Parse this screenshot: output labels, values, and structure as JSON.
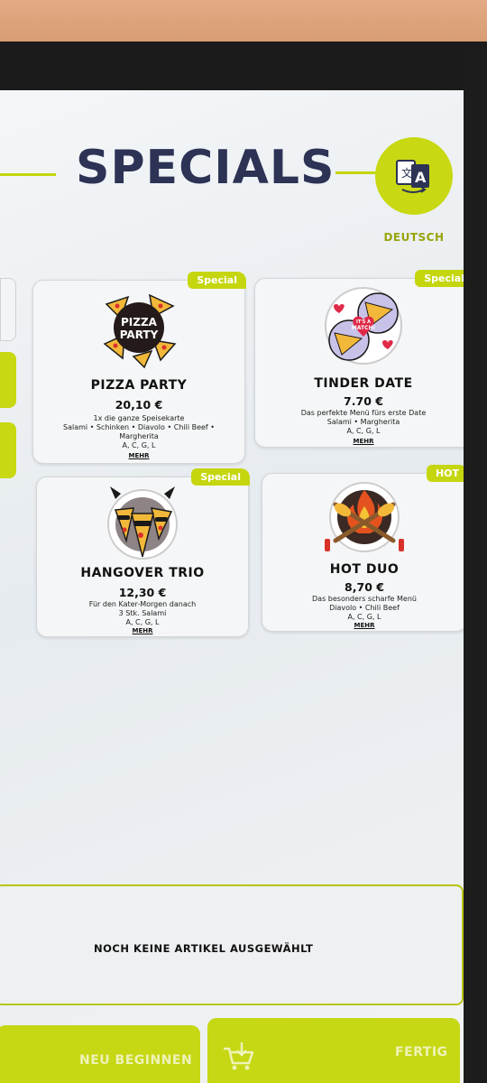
{
  "header": {
    "title": "SPECIALS",
    "language_label": "DEUTSCH",
    "language_icon": "translate-icon"
  },
  "products": [
    {
      "badge": "Special",
      "name": "PIZZA PARTY",
      "price": "20,10 €",
      "description": [
        "1x die ganze Speisekarte",
        "Salami • Schinken • Diavolo • Chili Beef •",
        "Margherita",
        "A, C, G, L"
      ],
      "more": "MEHR",
      "image_text": [
        "PIZZA",
        "PARTY"
      ]
    },
    {
      "badge": "Special",
      "name": "TINDER DATE",
      "price": "7.70 €",
      "description": [
        "Das perfekte Menü fürs erste Date",
        "Salami • Margherita",
        "A, C, G, L"
      ],
      "more": "MEHR",
      "image_text": [
        "IT'S A",
        "MATCH!"
      ]
    },
    {
      "badge": "Special",
      "name": "HANGOVER TRIO",
      "price": "12,30 €",
      "description": [
        "Für den Kater-Morgen danach",
        "3 Stk. Salami",
        "A, C, G, L"
      ],
      "more": "MEHR"
    },
    {
      "badge": "HOT",
      "name": "HOT DUO",
      "price": "8,70 €",
      "description": [
        "Das besonders scharfe Menü",
        "Diavolo • Chili Beef",
        "A, C, G, L"
      ],
      "more": "MEHR"
    }
  ],
  "cart": {
    "empty_text": "NOCH KEINE ARTIKEL AUSGEWÄHLT"
  },
  "footer": {
    "restart_label": "NEU BEGINNEN",
    "cart_icon": "cart-download-icon",
    "done_label": "FERTIG"
  },
  "colors": {
    "accent": "#c6d714",
    "title": "#2c3355"
  }
}
